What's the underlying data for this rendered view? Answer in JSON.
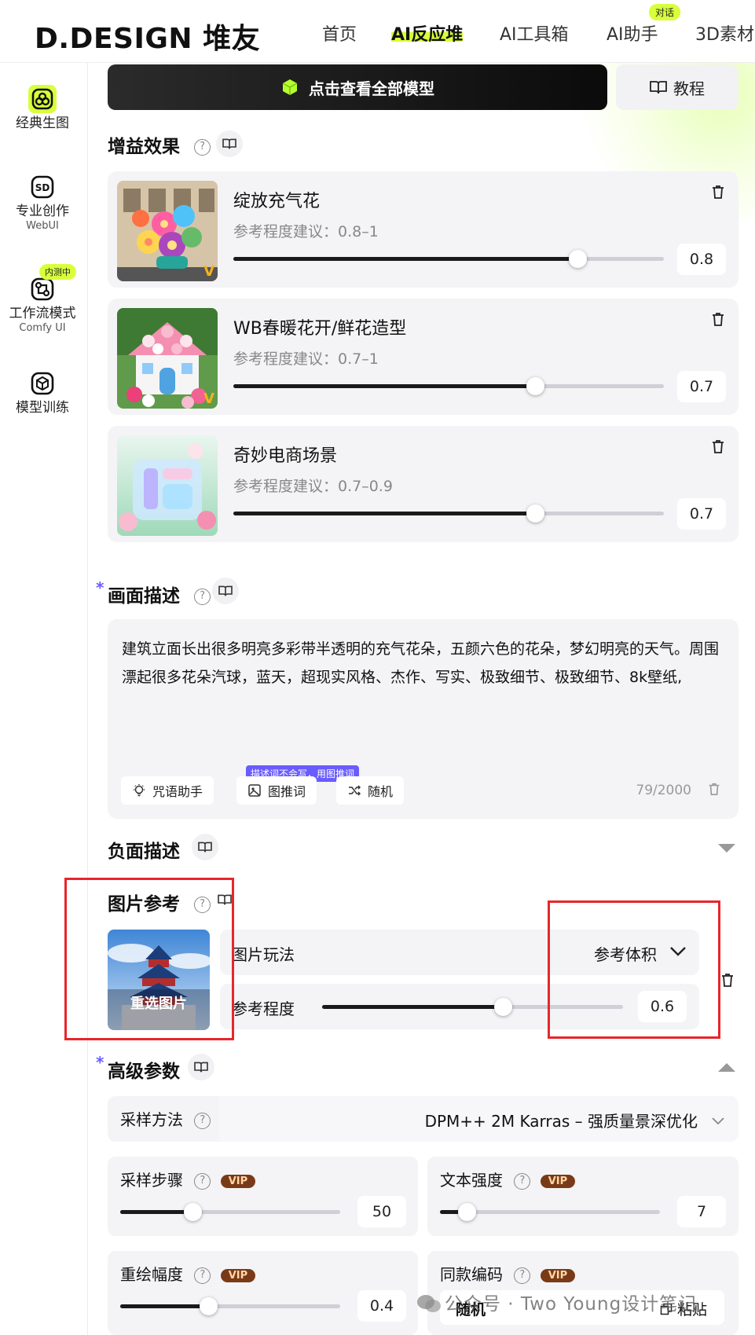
{
  "header": {
    "brand": "D.DESIGN 堆友",
    "nav": [
      "首页",
      "AI反应堆",
      "AI工具箱",
      "AI助手",
      "3D素材"
    ],
    "nav_active_index": 1,
    "assistant_badge": "对话"
  },
  "sidebar": {
    "items": [
      {
        "label": "经典生图",
        "sub": "",
        "icon": "classic-generate-icon"
      },
      {
        "label": "专业创作",
        "sub": "WebUI",
        "icon": "sd-icon"
      },
      {
        "label": "工作流模式",
        "sub": "Comfy UI",
        "icon": "workflow-icon",
        "tag": "内测中"
      },
      {
        "label": "模型训练",
        "sub": "",
        "icon": "model-train-icon"
      }
    ]
  },
  "toolbar": {
    "view_all_models": "点击查看全部模型",
    "tutorial": "教程"
  },
  "effects": {
    "title": "增益效果",
    "items": [
      {
        "title": "绽放充气花",
        "suggest": "参考程度建议：0.8–1",
        "value": "0.8",
        "level": 0.8
      },
      {
        "title": "WB春暖花开/鲜花造型",
        "suggest": "参考程度建议：0.7–1",
        "value": "0.7",
        "level": 0.7
      },
      {
        "title": "奇妙电商场景",
        "suggest": "参考程度建议：0.7–0.9",
        "value": "0.7",
        "level": 0.7
      }
    ]
  },
  "prompt": {
    "title": "画面描述",
    "text": "建筑立面长出很多明亮多彩带半透明的充气花朵，五颜六色的花朵，梦幻明亮的天气。周围漂起很多花朵汽球，蓝天，超现实风格、杰作、写实、极致细节、极致细节、8k壁纸,",
    "buttons": [
      "咒语助手",
      "图推词",
      "随机"
    ],
    "tip": "描述词不会写，用图推词",
    "counter": "79/2000"
  },
  "negative": {
    "title": "负面描述"
  },
  "image_ref": {
    "title": "图片参考",
    "reselect": "重选图片",
    "mode_label": "图片玩法",
    "mode_value": "参考体积",
    "strength_label": "参考程度",
    "strength_value": "0.6",
    "strength_level": 0.6
  },
  "advanced": {
    "title": "高级参数",
    "sampler_label": "采样方法",
    "sampler_value": "DPM++ 2M Karras – 强质量景深优化",
    "vip": "VIP",
    "params": [
      {
        "label": "采样步骤",
        "value": "50",
        "level": 0.33
      },
      {
        "label": "文本强度",
        "value": "7",
        "level": 0.12
      },
      {
        "label": "重绘幅度",
        "value": "0.4",
        "level": 0.4
      },
      {
        "label": "同款编码",
        "value": "",
        "random": "随机",
        "paste": "粘贴"
      }
    ]
  },
  "watermark": "公众号 · Two Young设计笔记",
  "colors": {
    "accent": "#d8ff3b",
    "purple": "#6a5cff",
    "vip_bg": "#7a3a18",
    "highlight_red": "#e8262a"
  }
}
